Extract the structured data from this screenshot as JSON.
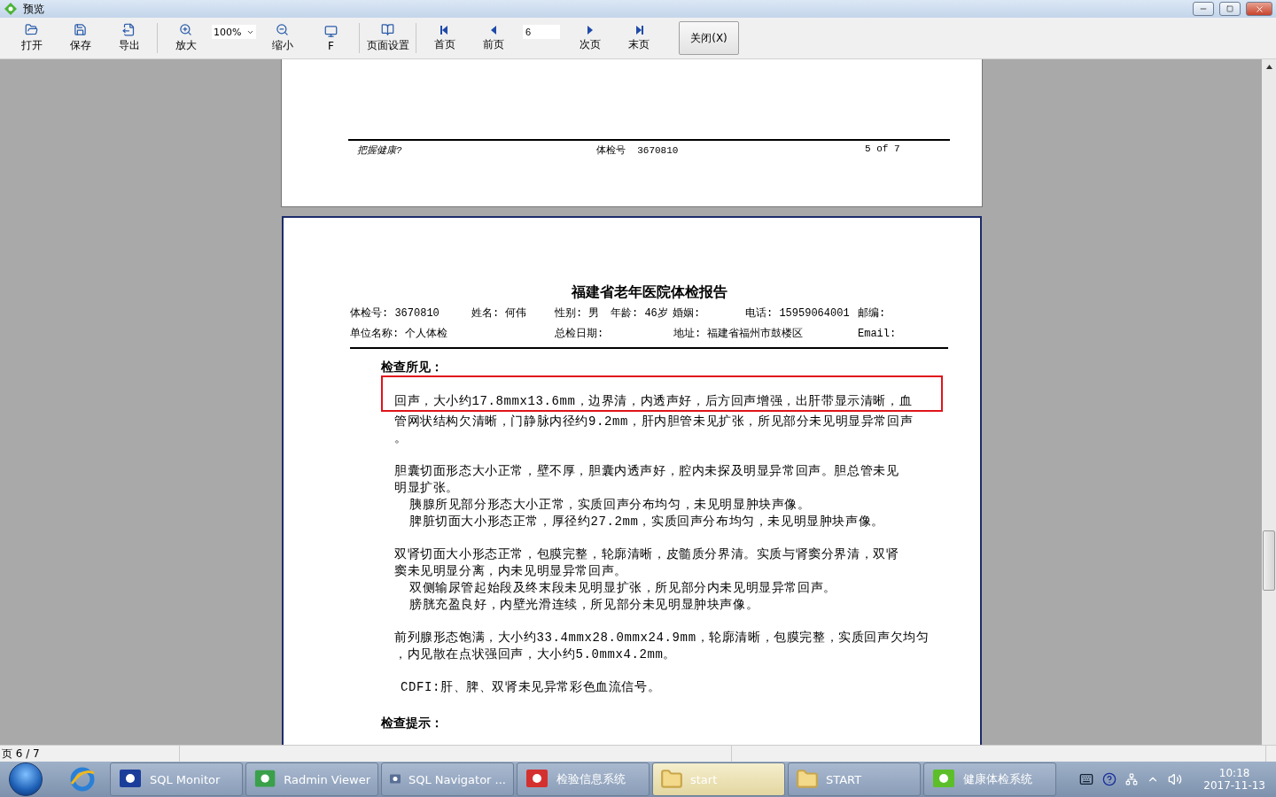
{
  "window": {
    "title": "预览"
  },
  "toolbar": [
    {
      "kind": "button",
      "label": "打开"
    },
    {
      "kind": "button",
      "label": "保存"
    },
    {
      "kind": "button",
      "label": "导出"
    },
    {
      "kind": "separator"
    },
    {
      "kind": "button",
      "label": "放大"
    },
    {
      "kind": "zoom_select",
      "value": "100%"
    },
    {
      "kind": "button",
      "label": "缩小"
    },
    {
      "kind": "button",
      "label": "F"
    },
    {
      "kind": "separator"
    },
    {
      "kind": "button",
      "label": "页面设置"
    },
    {
      "kind": "separator"
    },
    {
      "kind": "button",
      "label": "首页"
    },
    {
      "kind": "button",
      "label": "前页"
    },
    {
      "kind": "page_field",
      "value": "6"
    },
    {
      "kind": "button",
      "label": "次页"
    },
    {
      "kind": "button",
      "label": "末页"
    },
    {
      "kind": "close",
      "label": "关闭(X)"
    }
  ],
  "previous_page": {
    "footer_left": "把握健康?",
    "footer_center": "体检号  3670810",
    "footer_right": "5 of 7"
  },
  "report": {
    "title": "福建省老年医院体检报告",
    "info_rows": [
      [
        "体检号: 3670810",
        "姓名: 何伟",
        "性别: 男",
        "年龄: 46岁",
        "婚姻:",
        "电话: 15959064001",
        "邮编:"
      ],
      [
        "单位名称: 个人体检",
        "总检日期:",
        "地址: 福建省福州市鼓楼区",
        "Email:"
      ]
    ],
    "findings_heading": "检查所见：",
    "blocks": [
      {
        "highlighted": true,
        "lines": [
          {
            "kind": "line",
            "text": "回声，大小约17.8mmx13.6mm，边界清，内透声好，后方回声增强，出肝带显示清晰，血"
          }
        ]
      },
      {
        "highlighted": false,
        "lines": [
          {
            "kind": "line",
            "text": "管网状结构欠清晰，门静脉内径约9.2mm，肝内胆管未见扩张，所见部分未见明显异常回声"
          },
          {
            "kind": "line",
            "text": "。"
          },
          {
            "kind": "gap"
          },
          {
            "kind": "line",
            "text": "胆囊切面形态大小正常，壁不厚，胆囊内透声好，腔内未探及明显异常回声。胆总管未见"
          },
          {
            "kind": "line",
            "text": "明显扩张。"
          },
          {
            "kind": "indented",
            "text": "胰腺所见部分形态大小正常，实质回声分布均匀，未见明显肿块声像。"
          },
          {
            "kind": "indented",
            "text": "脾脏切面大小形态正常，厚径约27.2mm，实质回声分布均匀，未见明显肿块声像。"
          },
          {
            "kind": "gap"
          },
          {
            "kind": "line",
            "text": "双肾切面大小形态正常，包膜完整，轮廓清晰，皮髓质分界清。实质与肾窦分界清，双肾"
          },
          {
            "kind": "line",
            "text": "窦未见明显分离，内未见明显异常回声。"
          },
          {
            "kind": "indented",
            "text": "双侧输尿管起始段及终末段未见明显扩张，所见部分内未见明显异常回声。"
          },
          {
            "kind": "indented",
            "text": "膀胱充盈良好，内壁光滑连续，所见部分未见明显肿块声像。"
          },
          {
            "kind": "gap"
          },
          {
            "kind": "line",
            "text": "前列腺形态饱满，大小约33.4mmx28.0mmx24.9mm，轮廓清晰，包膜完整，实质回声欠均匀"
          },
          {
            "kind": "line",
            "text": "，内见散在点状强回声，大小约5.0mmx4.2mm。"
          },
          {
            "kind": "gap"
          },
          {
            "kind": "cdfi",
            "text": "CDFI:肝、脾、双肾未见异常彩色血流信号。"
          }
        ]
      }
    ],
    "tips_heading": "检查提示："
  },
  "status_bar": {
    "page": "页 6 / 7"
  },
  "taskbar": {
    "tasks": [
      {
        "label": "SQL Monitor",
        "selected": false
      },
      {
        "label": "Radmin Viewer",
        "selected": false
      },
      {
        "label": "SQL Navigator ...",
        "selected": false
      },
      {
        "label": "检验信息系统",
        "selected": false
      },
      {
        "label": "start",
        "selected": true
      },
      {
        "label": "START",
        "selected": false
      },
      {
        "label": "健康体检系统",
        "selected": false
      }
    ],
    "time": "10:18",
    "date": "2017-11-13"
  }
}
